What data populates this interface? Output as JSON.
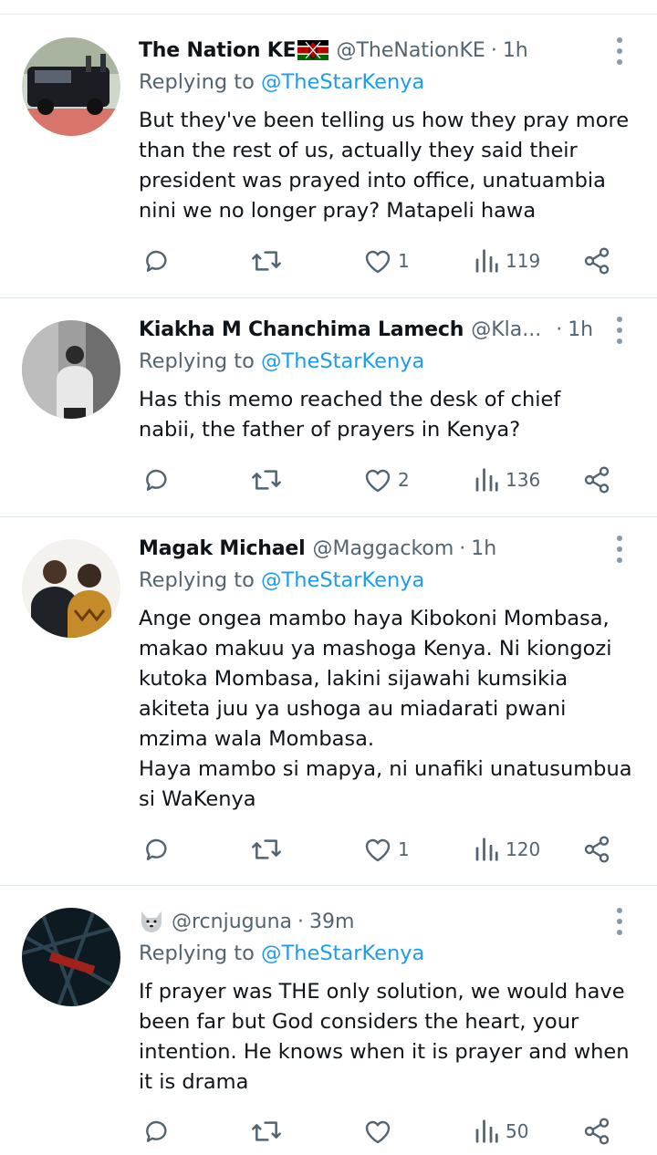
{
  "replying_prefix": "Replying to",
  "tweets": [
    {
      "name": "The Nation KE",
      "flag_icon": "kenya-flag-icon",
      "handle": "@TheNationKE",
      "sep": "·",
      "time": "1h",
      "reply_to": "@TheStarKenya",
      "text": "But they've been telling us how they pray more than the rest of us, actually they said their president was prayed into office, unatuambia nini we no longer pray? Matapeli hawa",
      "likes": "1",
      "views": "119"
    },
    {
      "name": "Kiakha M Chanchima Lamech",
      "handle": "@Kla...",
      "sep": "·",
      "time": "1h",
      "reply_to": "@TheStarKenya",
      "text": "Has this memo reached the desk of chief nabii, the father of prayers in Kenya?",
      "likes": "2",
      "views": "136"
    },
    {
      "name": "Magak Michael",
      "handle": "@Maggackom",
      "sep": "·",
      "time": "1h",
      "reply_to": "@TheStarKenya",
      "text": "Ange ongea mambo haya Kibokoni Mombasa, makao makuu ya mashoga Kenya. Ni kiongozi kutoka Mombasa, lakini sijawahi kumsikia akiteta juu ya ushoga au miadarati pwani mzima wala Mombasa.\nHaya mambo si mapya, ni unafiki unatusumbua si WaKenya",
      "likes": "1",
      "views": "120"
    },
    {
      "name_icon": "wolf-emoji-icon",
      "handle": "@rcnjuguna",
      "sep": "·",
      "time": "39m",
      "reply_to": "@TheStarKenya",
      "text": "If prayer was THE only solution, we would have been far but God considers the heart, your intention. He knows when it is prayer and when it is drama",
      "likes": "",
      "views": "50"
    }
  ],
  "icons": {
    "reply": "reply-icon",
    "retweet": "retweet-icon",
    "like": "heart-icon",
    "views": "views-icon",
    "share": "share-icon",
    "more": "more-options-icon"
  },
  "colors": {
    "mention": "#1d9bf0",
    "secondary": "#536471",
    "text": "#0f1419"
  }
}
